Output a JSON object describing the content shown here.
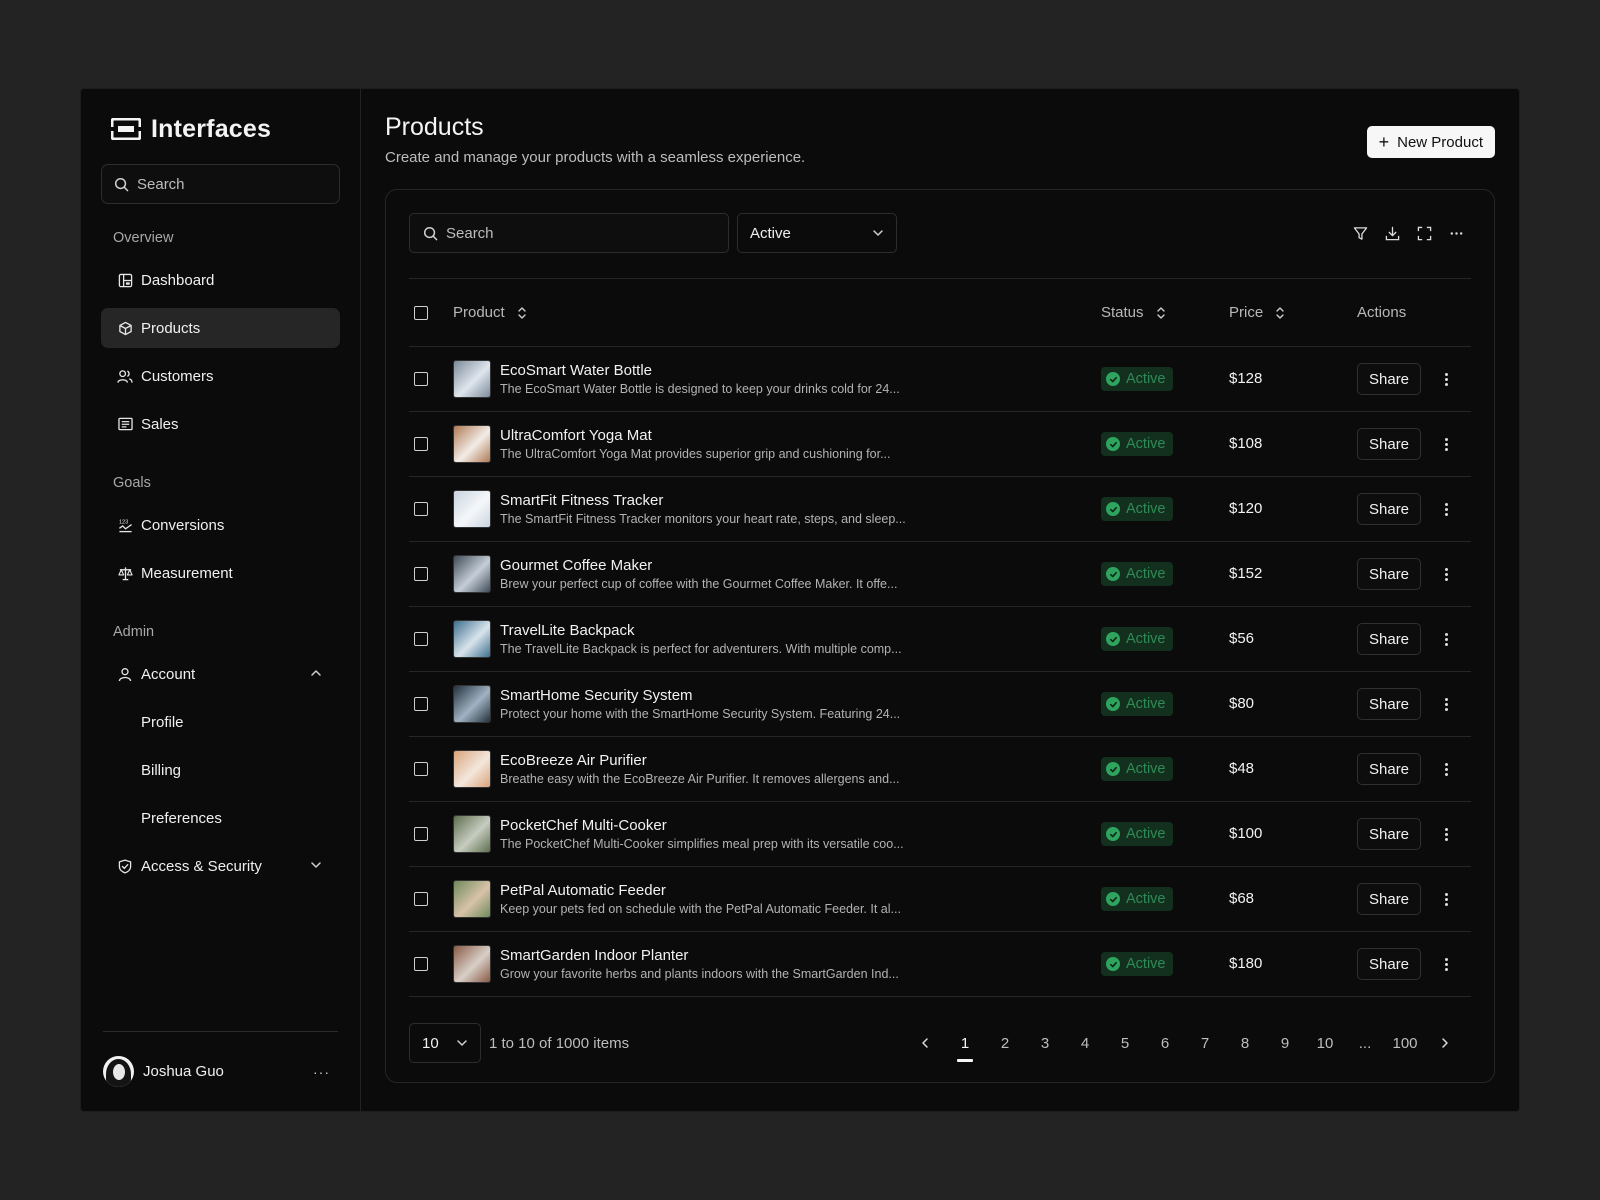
{
  "brand": {
    "name": "Interfaces"
  },
  "sidebar": {
    "search_placeholder": "Search",
    "sections": [
      {
        "label": "Overview",
        "items": [
          {
            "label": "Dashboard",
            "icon": "dashboard-icon"
          },
          {
            "label": "Products",
            "icon": "cube-icon",
            "active": true
          },
          {
            "label": "Customers",
            "icon": "users-icon"
          },
          {
            "label": "Sales",
            "icon": "receipt-icon"
          }
        ]
      },
      {
        "label": "Goals",
        "items": [
          {
            "label": "Conversions",
            "icon": "conversions-icon"
          },
          {
            "label": "Measurement",
            "icon": "scale-icon"
          }
        ]
      },
      {
        "label": "Admin",
        "items": [
          {
            "label": "Account",
            "icon": "user-icon",
            "expanded": true
          },
          {
            "label": "Access & Security",
            "icon": "shield-icon",
            "expanded": false
          }
        ]
      }
    ],
    "account_sub": [
      "Profile",
      "Billing",
      "Preferences"
    ],
    "user": {
      "name": "Joshua Guo",
      "more": "···"
    }
  },
  "header": {
    "title": "Products",
    "subtitle": "Create and manage your products with a seamless experience.",
    "new_button": "New Product"
  },
  "toolbar": {
    "search_placeholder": "Search",
    "status_filter": "Active",
    "icons": [
      "filter-icon",
      "download-icon",
      "fullscreen-icon",
      "more-icon"
    ]
  },
  "table": {
    "headers": {
      "product": "Product",
      "status": "Status",
      "price": "Price",
      "actions": "Actions"
    },
    "share_label": "Share",
    "rows": [
      {
        "name": "EcoSmart Water Bottle",
        "desc": "The EcoSmart Water Bottle is designed to keep your drinks cold for 24...",
        "status": "Active",
        "price": "$128",
        "thumb": [
          "#7b8a99",
          "#dfe6ee"
        ]
      },
      {
        "name": "UltraComfort Yoga Mat",
        "desc": "The UltraComfort Yoga Mat provides superior grip and cushioning for...",
        "status": "Active",
        "price": "$108",
        "thumb": [
          "#b07a55",
          "#f2ece6"
        ]
      },
      {
        "name": "SmartFit Fitness Tracker",
        "desc": "The SmartFit Fitness Tracker monitors your heart rate, steps, and sleep...",
        "status": "Active",
        "price": "$120",
        "thumb": [
          "#c9d4df",
          "#f5f7fa"
        ]
      },
      {
        "name": "Gourmet Coffee Maker",
        "desc": "Brew your perfect cup of coffee with the Gourmet Coffee Maker. It offe...",
        "status": "Active",
        "price": "$152",
        "thumb": [
          "#3f4b57",
          "#c5ced8"
        ]
      },
      {
        "name": "TravelLite Backpack",
        "desc": "The TravelLite Backpack is perfect for adventurers. With multiple comp...",
        "status": "Active",
        "price": "$56",
        "thumb": [
          "#3d6f8e",
          "#d9e4ec"
        ]
      },
      {
        "name": "SmartHome Security System",
        "desc": "Protect your home with the SmartHome Security System. Featuring 24...",
        "status": "Active",
        "price": "$80",
        "thumb": [
          "#25313c",
          "#9fb2c3"
        ]
      },
      {
        "name": "EcoBreeze Air Purifier",
        "desc": "Breathe easy with the EcoBreeze Air Purifier. It removes allergens and...",
        "status": "Active",
        "price": "$48",
        "thumb": [
          "#d9a47a",
          "#f3e7dc"
        ]
      },
      {
        "name": "PocketChef Multi-Cooker",
        "desc": "The PocketChef Multi-Cooker simplifies meal prep with its versatile coo...",
        "status": "Active",
        "price": "$100",
        "thumb": [
          "#5e6f4d",
          "#c6ccc0"
        ]
      },
      {
        "name": "PetPal Automatic Feeder",
        "desc": "Keep your pets fed on schedule with the PetPal Automatic Feeder. It al...",
        "status": "Active",
        "price": "$68",
        "thumb": [
          "#6f8a5c",
          "#d8c3a8"
        ]
      },
      {
        "name": "SmartGarden Indoor Planter",
        "desc": "Grow your favorite herbs and plants indoors with the SmartGarden Ind...",
        "status": "Active",
        "price": "$180",
        "thumb": [
          "#8a5a45",
          "#d8cfc8"
        ]
      }
    ]
  },
  "pagination": {
    "per_page": "10",
    "info": "1 to 10 of 1000 items",
    "pages": [
      "1",
      "2",
      "3",
      "4",
      "5",
      "6",
      "7",
      "8",
      "9",
      "10",
      "...",
      "100"
    ],
    "current": "1"
  },
  "colors": {
    "status_active_bg": "#13301f",
    "status_active_fg": "#2e8b55",
    "accent": "#f7f7f7"
  }
}
